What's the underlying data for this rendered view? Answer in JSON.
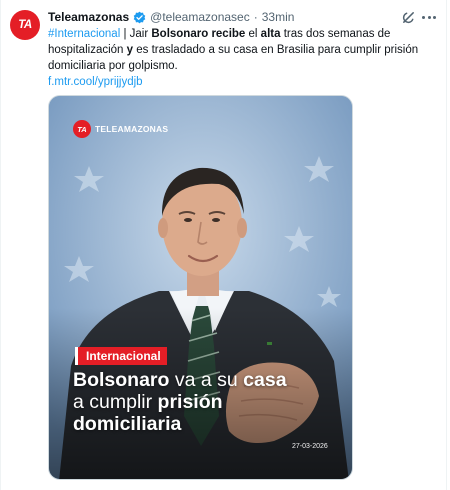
{
  "account": {
    "avatar_text": "TA",
    "name": "Teleamazonas",
    "handle": "@teleamazonasec",
    "separator": "·",
    "time": "33min"
  },
  "tweet": {
    "hashtag": "#Internacional",
    "divider": " | Jair ",
    "bold_name": "Bolsonaro",
    "bold_verb": "recibe",
    "text_el": " el ",
    "bold_alta": "alta",
    "text_mid": " tras dos semanas de hospitalización ",
    "bold_y": "y",
    "text_end": " es trasladado a su casa en Brasilia para cumplir prisión domiciliaria por golpismo.",
    "link": "f.mtr.cool/yprijjydjb"
  },
  "media": {
    "brand_badge": "TA",
    "brand_name": "TELEAMAZONAS",
    "tag": "Internacional",
    "headline": {
      "part1_bold": "Bolsonaro",
      "part1_thin": " va a su ",
      "part1_bold2": "casa",
      "part2_thin": "a cumplir ",
      "part2_bold": "prisión",
      "part3_bold": "domiciliaria"
    },
    "photo_date": "27-03-2026"
  },
  "icons": {
    "verified": "verified-badge-icon",
    "grok": "grok-icon",
    "more": "more-icon"
  },
  "colors": {
    "brand_red": "#e41e26",
    "link_blue": "#1d9bf0",
    "muted": "#536471"
  }
}
